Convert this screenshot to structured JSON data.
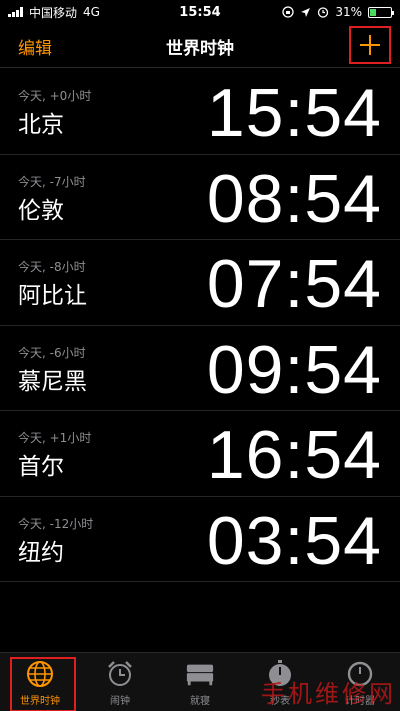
{
  "status_bar": {
    "carrier": "中国移动",
    "network": "4G",
    "time": "15:54",
    "battery_percent": "31%",
    "battery_level": 0.31
  },
  "nav": {
    "edit_label": "编辑",
    "title": "世界时钟"
  },
  "clocks": [
    {
      "offset": "今天, +0小时",
      "city": "北京",
      "time": "15:54"
    },
    {
      "offset": "今天, -7小时",
      "city": "伦敦",
      "time": "08:54"
    },
    {
      "offset": "今天, -8小时",
      "city": "阿比让",
      "time": "07:54"
    },
    {
      "offset": "今天, -6小时",
      "city": "慕尼黑",
      "time": "09:54"
    },
    {
      "offset": "今天, +1小时",
      "city": "首尔",
      "time": "16:54"
    },
    {
      "offset": "今天, -12小时",
      "city": "纽约",
      "time": "03:54"
    }
  ],
  "tabs": [
    {
      "label": "世界时钟",
      "icon": "globe-icon",
      "active": true
    },
    {
      "label": "闹钟",
      "icon": "alarm-clock-icon",
      "active": false
    },
    {
      "label": "就寝",
      "icon": "bed-icon",
      "active": false
    },
    {
      "label": "秒表",
      "icon": "stopwatch-icon",
      "active": false
    },
    {
      "label": "计时器",
      "icon": "timer-icon",
      "active": false
    }
  ],
  "watermark": "手机维修网",
  "colors": {
    "accent": "#ff9500",
    "highlight": "#e02020",
    "inactive": "#8e8e93"
  }
}
